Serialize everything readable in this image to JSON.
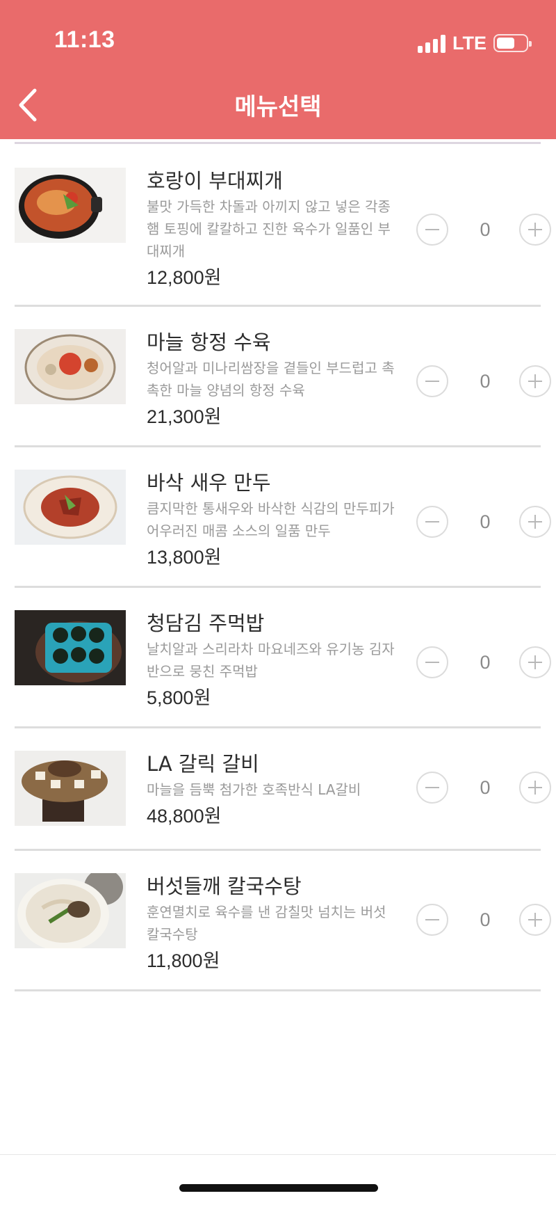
{
  "status_bar": {
    "time": "11:13",
    "network": "LTE"
  },
  "header": {
    "title": "메뉴선택",
    "back_icon": "chevron-left-icon"
  },
  "colors": {
    "header_bg": "#e96b6b",
    "divider": "#dddddd"
  },
  "menu": [
    {
      "name": "호랑이 부대찌개",
      "description": "불맛 가득한 차돌과 아끼지 않고 넣은 각종 햄 토핑에 칼칼하고 진한 육수가 일품인 부대찌개",
      "price": "12,800원",
      "quantity": "0"
    },
    {
      "name": "마늘 항정 수육",
      "description": "청어알과 미나리쌈장을 곁들인 부드럽고 촉촉한 마늘 양념의 항정 수육",
      "price": "21,300원",
      "quantity": "0"
    },
    {
      "name": "바삭 새우 만두",
      "description": "큼지막한 통새우와 바삭한 식감의 만두피가 어우러진 매콤 소스의 일품 만두",
      "price": "13,800원",
      "quantity": "0"
    },
    {
      "name": "청담김 주먹밥",
      "description": "날치알과 스리라차 마요네즈와 유기농 김자반으로 뭉친 주먹밥",
      "price": "5,800원",
      "quantity": "0"
    },
    {
      "name": "LA 갈릭 갈비",
      "description": "마늘을 듬뿍 첨가한 호족반식 LA갈비",
      "price": "48,800원",
      "quantity": "0"
    },
    {
      "name": "버섯들깨 칼국수탕",
      "description": "훈연멸치로 육수를 낸 감칠맛 넘치는 버섯 칼국수탕",
      "price": "11,800원",
      "quantity": "0"
    }
  ]
}
